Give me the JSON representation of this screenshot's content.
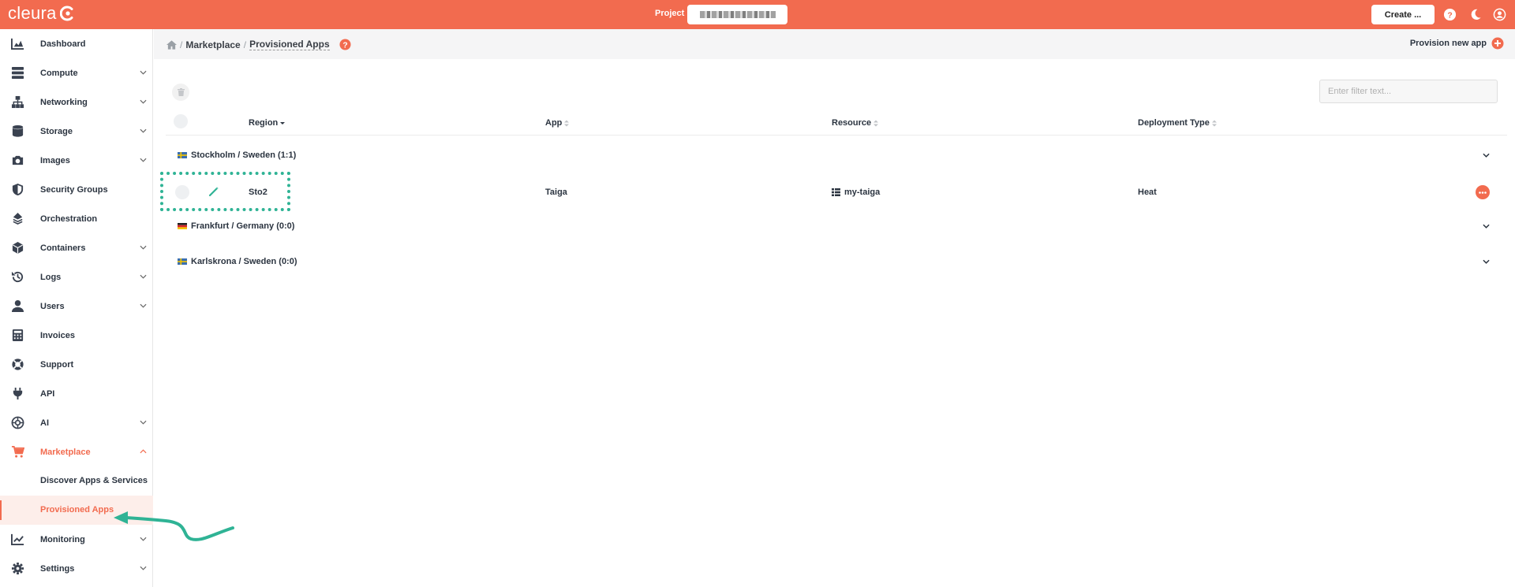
{
  "topbar": {
    "logo_text": "cleura",
    "project_label": "Project",
    "create_label": "Create ...",
    "icons": [
      "help-icon",
      "moon-icon",
      "user-icon"
    ]
  },
  "sidebar": {
    "items": [
      {
        "label": "Dashboard",
        "icon": "chart-icon",
        "chevron": false
      },
      {
        "label": "Compute",
        "icon": "server-icon",
        "chevron": true
      },
      {
        "label": "Networking",
        "icon": "network-icon",
        "chevron": true
      },
      {
        "label": "Storage",
        "icon": "database-icon",
        "chevron": true
      },
      {
        "label": "Images",
        "icon": "camera-icon",
        "chevron": true
      },
      {
        "label": "Security Groups",
        "icon": "shield-icon",
        "chevron": false
      },
      {
        "label": "Orchestration",
        "icon": "orchestration-icon",
        "chevron": false
      },
      {
        "label": "Containers",
        "icon": "cube-icon",
        "chevron": true
      },
      {
        "label": "Logs",
        "icon": "history-icon",
        "chevron": true
      },
      {
        "label": "Users",
        "icon": "user-icon",
        "chevron": true
      },
      {
        "label": "Invoices",
        "icon": "calculator-icon",
        "chevron": false
      },
      {
        "label": "Support",
        "icon": "lifebuoy-icon",
        "chevron": false
      },
      {
        "label": "API",
        "icon": "plug-icon",
        "chevron": false
      },
      {
        "label": "AI",
        "icon": "ai-icon",
        "chevron": true
      },
      {
        "label": "Marketplace",
        "icon": "cart-icon",
        "chevron": true,
        "active": true
      }
    ],
    "marketplace_sub": [
      "Discover Apps & Services",
      "Provisioned Apps"
    ],
    "bottom_items": [
      {
        "label": "Monitoring",
        "icon": "line-chart-icon",
        "chevron": true
      },
      {
        "label": "Settings",
        "icon": "gear-icon",
        "chevron": true
      }
    ]
  },
  "breadcrumb": {
    "items": [
      "Marketplace",
      "Provisioned Apps"
    ],
    "provision_label": "Provision new app"
  },
  "filter": {
    "placeholder": "Enter filter text..."
  },
  "table": {
    "columns": [
      "Region",
      "App",
      "Resource",
      "Deployment Type"
    ],
    "groups": [
      {
        "label": "Stockholm / Sweden",
        "count": "(1:1)",
        "flag": "se"
      },
      {
        "label": "Frankfurt / Germany",
        "count": "(0:0)",
        "flag": "de"
      },
      {
        "label": "Karlskrona / Sweden",
        "count": "(0:0)",
        "flag": "se"
      }
    ],
    "row": {
      "region": "Sto2",
      "app": "Taiga",
      "resource": "my-taiga",
      "deployment": "Heat"
    }
  },
  "colors": {
    "accent": "#f26b4f",
    "annotation": "#2fb395",
    "text": "#2b3440"
  }
}
